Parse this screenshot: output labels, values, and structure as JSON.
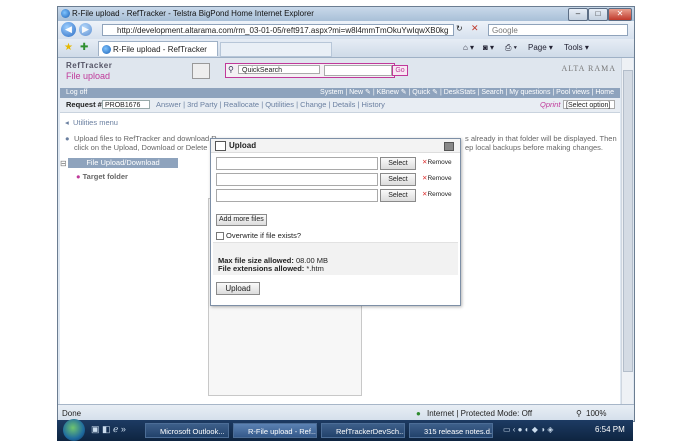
{
  "window": {
    "title": "R-File upload - RefTracker - Telstra BigPond Home Internet Explorer",
    "address": "http://development.altarama.com/rm_03-01-05/reft917.aspx?mi=w8l4mmTmOkuYwIqwXB0kg",
    "search_placeholder": "Google",
    "tab_label": "R-File upload - RefTracker",
    "toolbar": {
      "page": "Page ▾",
      "tools": "Tools ▾"
    }
  },
  "app": {
    "brand": "RefTracker",
    "page_title": "File upload",
    "vendor": "ALTA RAMA",
    "quicksearch_label": "QuickSearch",
    "go_label": "Go",
    "log_off": "Log off",
    "nav_links": "System  |  New  ✎ |  KBnew  ✎ |  Quick  ✎ |  DeskStats  |  Search  |  My questions  |  Pool views  |  Home",
    "request_label": "Request #",
    "request_number": "PROB1676",
    "request_links": "Answer  |  3rd Party  |  Reallocate  |  Qutilities  |  Change  |  Details  |  History",
    "qprint": "Qprint",
    "select_option": "[Select option]",
    "utilities_menu": "Utilities menu",
    "info_line1": "Upload files to RefTracker and download R",
    "info_line1_end": "s already in that folder will be displayed. Then",
    "info_line2": "click on the Upload, Download or Delete ic",
    "info_line2_end": "ep local backups before making changes.",
    "tree_header": "File Upload/Download",
    "tree_folder": "Target folder"
  },
  "dialog": {
    "title": "Upload",
    "select_label": "Select",
    "remove_label": "Remove",
    "add_more": "Add more files",
    "overwrite": "Overwrite if file exists?",
    "max_size": "Max file size allowed:",
    "max_size_value": "08.00 MB",
    "extensions": "File extensions allowed:",
    "extensions_value": "*.htm",
    "upload_button": "Upload"
  },
  "status": {
    "left": "Done",
    "zone": "Internet | Protected Mode: Off",
    "zoom": "100%"
  },
  "taskbar": {
    "items": [
      "Microsoft Outlook...",
      "R-File upload - Ref...",
      "RefTrackerDevSch...",
      "315 release notes.d..."
    ],
    "clock": "6:54 PM"
  }
}
